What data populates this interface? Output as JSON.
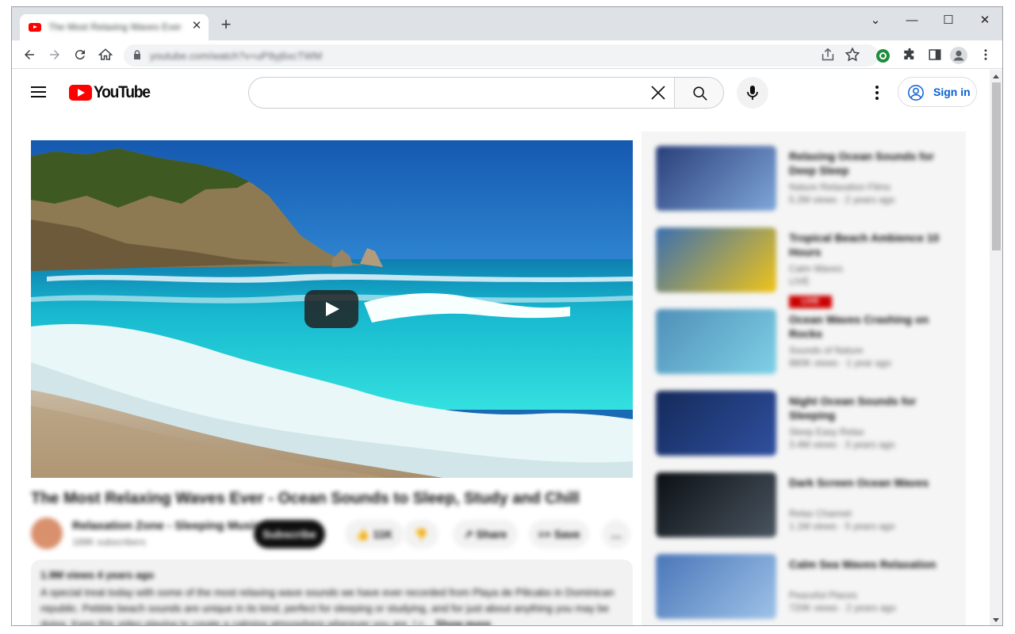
{
  "browser": {
    "tab_title": "The Most Relaxing Waves Ever - Ocean Sounds to Sleep",
    "tab_close": "✕",
    "new_tab": "+",
    "url": "youtube.com/watch?v=uP9yj6xcTWM",
    "window_controls": {
      "tabsearch": "⌄",
      "minimize": "—",
      "maximize": "☐",
      "close": "✕"
    }
  },
  "youtube": {
    "logo_text": "YouTube",
    "search": {
      "value": "",
      "placeholder": ""
    },
    "signin_label": "Sign in"
  },
  "video": {
    "title": "The Most Relaxing Waves Ever - Ocean Sounds to Sleep, Study and Chill",
    "channel_name": "Relaxation Zone - Sleeping Music",
    "channel_subs": "188K subscribers",
    "subscribe_label": "Subscribe",
    "actions": [
      {
        "name": "like",
        "label": "👍  11K"
      },
      {
        "name": "dislike",
        "label": "👎"
      },
      {
        "name": "share",
        "label": "↗  Share"
      },
      {
        "name": "save",
        "label": "≡+  Save"
      },
      {
        "name": "more",
        "label": "…"
      }
    ],
    "description": {
      "meta": "1.9M views  4 years ago",
      "body": "A special treat today with some of the most relaxing wave sounds we have ever recorded from Playa de Pilicabo in Dominican republic. Pebble beach sounds are unique in its kind, perfect for sleeping or studying, and for just about anything you may be doing. Keep this video playing to create a calming atmosphere wherever you are. I c...",
      "more": "Show more"
    }
  },
  "recommendations": [
    {
      "title": "Relaxing Ocean Sounds for Deep Sleep",
      "channel": "Nature Relaxation Films",
      "meta": "5.2M views · 2 years ago",
      "colors": [
        "#2a3f7a",
        "#7fa6d9"
      ]
    },
    {
      "title": "Tropical Beach Ambience 10 Hours",
      "channel": "Calm Waves",
      "meta": "LIVE",
      "colors": [
        "#3a6fb0",
        "#f0c419"
      ],
      "badge": "LIVE"
    },
    {
      "title": "Ocean Waves Crashing on Rocks",
      "channel": "Sounds of Nature",
      "meta": "980K views · 1 year ago",
      "colors": [
        "#4f8fb8",
        "#7fd1e6"
      ]
    },
    {
      "title": "Night Ocean Sounds for Sleeping",
      "channel": "Sleep Easy Relax",
      "meta": "3.4M views · 3 years ago",
      "colors": [
        "#142a5a",
        "#3050a0"
      ]
    },
    {
      "title": "Dark Screen Ocean Waves",
      "channel": "Relax Channel",
      "meta": "1.1M views · 5 years ago",
      "colors": [
        "#0b0f14",
        "#4a5560"
      ]
    },
    {
      "title": "Calm Sea Waves Relaxation",
      "channel": "Peaceful Places",
      "meta": "720K views · 2 years ago",
      "colors": [
        "#4a76b8",
        "#9ec3e8"
      ]
    }
  ]
}
